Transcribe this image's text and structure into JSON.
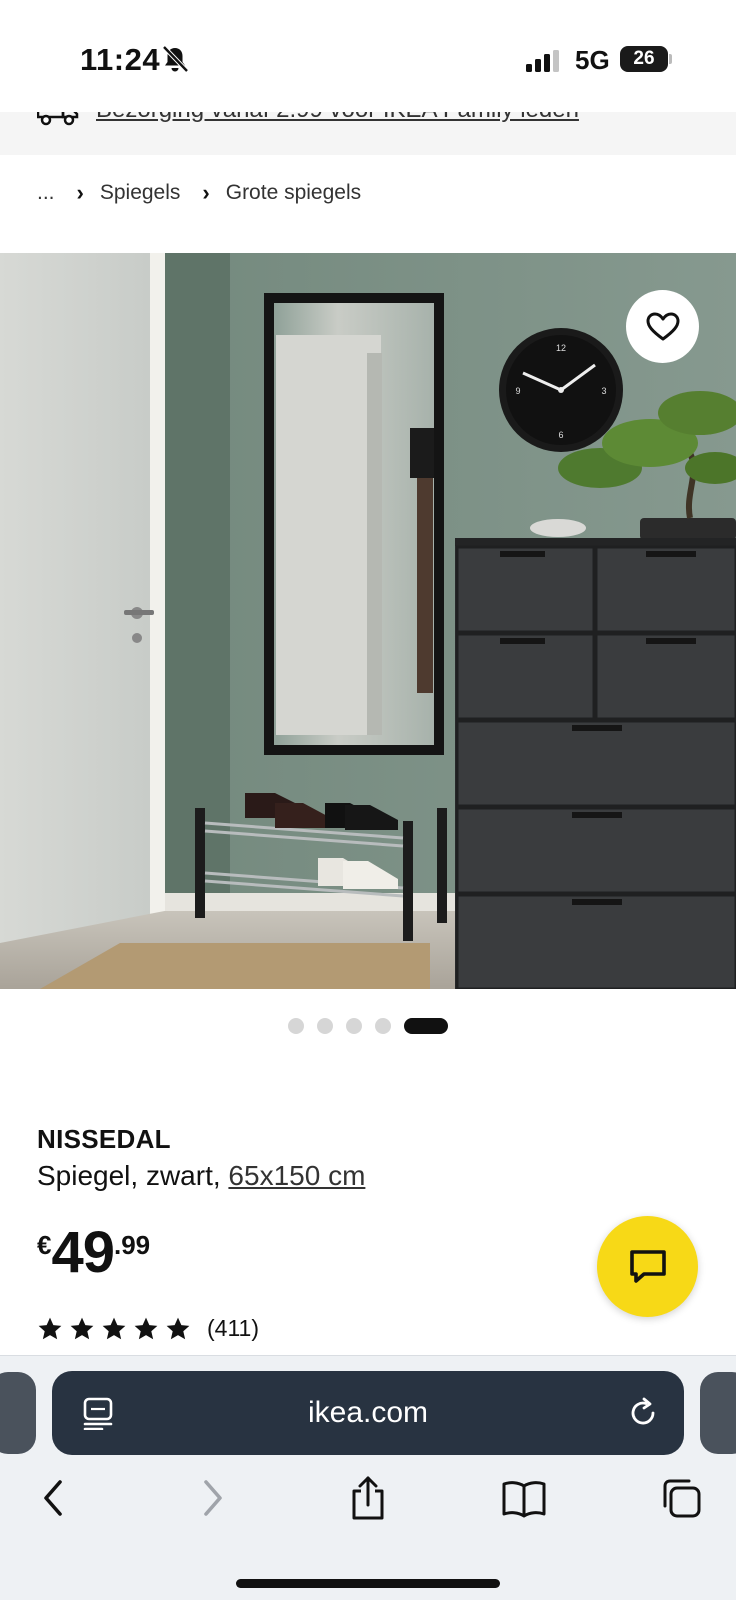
{
  "status_bar": {
    "time": "11:24",
    "network": "5G",
    "battery": "26"
  },
  "banner": {
    "text": "Bezorging vanaf 2.99 voor IKEA Family leden",
    "icon": "truck-icon"
  },
  "breadcrumb": {
    "ellipsis": "...",
    "items": [
      "Spiegels",
      "Grote spiegels"
    ],
    "separator": "›"
  },
  "gallery": {
    "image_count": 5,
    "active_index": 4,
    "favorite_icon": "heart-icon"
  },
  "product": {
    "name": "NISSEDAL",
    "description": "Spiegel, zwart, ",
    "size": "65x150 cm",
    "price": {
      "currency": "€",
      "integer": "49",
      "decimal": ".99"
    },
    "rating": {
      "stars": 5,
      "count": "(411)"
    }
  },
  "chat": {
    "icon": "chat-icon",
    "color": "#f7d917"
  },
  "browser": {
    "url": "ikea.com",
    "toolbar": [
      "back-icon",
      "forward-icon",
      "share-icon",
      "bookmarks-icon",
      "tabs-icon"
    ]
  }
}
